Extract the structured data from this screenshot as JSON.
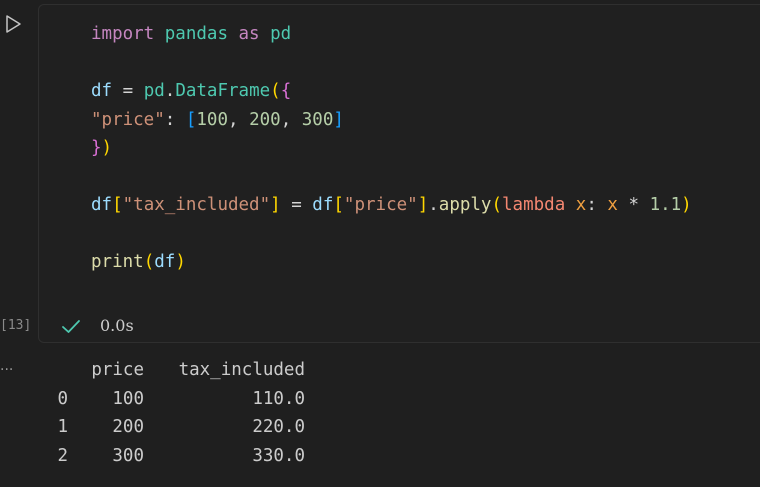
{
  "cell": {
    "execution_count": "[13]",
    "status_duration": "0.0s",
    "code_lines": [
      [
        {
          "t": "import",
          "c": "kw-import"
        },
        {
          "t": " ",
          "c": "op"
        },
        {
          "t": "pandas",
          "c": "mod"
        },
        {
          "t": " as ",
          "c": "kw-import"
        },
        {
          "t": "pd",
          "c": "mod"
        }
      ],
      [],
      [
        {
          "t": "df",
          "c": "var"
        },
        {
          "t": " = ",
          "c": "op"
        },
        {
          "t": "pd",
          "c": "mod"
        },
        {
          "t": ".",
          "c": "op"
        },
        {
          "t": "DataFrame",
          "c": "mod"
        },
        {
          "t": "(",
          "c": "b1"
        },
        {
          "t": "{",
          "c": "b2"
        }
      ],
      [
        {
          "t": "\"price\"",
          "c": "str"
        },
        {
          "t": ": ",
          "c": "op"
        },
        {
          "t": "[",
          "c": "b3"
        },
        {
          "t": "100",
          "c": "num"
        },
        {
          "t": ", ",
          "c": "op"
        },
        {
          "t": "200",
          "c": "num"
        },
        {
          "t": ", ",
          "c": "op"
        },
        {
          "t": "300",
          "c": "num"
        },
        {
          "t": "]",
          "c": "b3"
        }
      ],
      [
        {
          "t": "}",
          "c": "b2"
        },
        {
          "t": ")",
          "c": "b1"
        }
      ],
      [],
      [
        {
          "t": "df",
          "c": "var"
        },
        {
          "t": "[",
          "c": "b1"
        },
        {
          "t": "\"tax_included\"",
          "c": "str"
        },
        {
          "t": "]",
          "c": "b1"
        },
        {
          "t": " = ",
          "c": "op"
        },
        {
          "t": "df",
          "c": "var"
        },
        {
          "t": "[",
          "c": "b1"
        },
        {
          "t": "\"price\"",
          "c": "str"
        },
        {
          "t": "]",
          "c": "b1"
        },
        {
          "t": ".",
          "c": "op"
        },
        {
          "t": "apply",
          "c": "fn"
        },
        {
          "t": "(",
          "c": "b1"
        },
        {
          "t": "lambda",
          "c": "kw-lambda"
        },
        {
          "t": " ",
          "c": "op"
        },
        {
          "t": "x",
          "c": "param"
        },
        {
          "t": ": ",
          "c": "op"
        },
        {
          "t": "x",
          "c": "param"
        },
        {
          "t": " * ",
          "c": "op"
        },
        {
          "t": "1.1",
          "c": "num"
        },
        {
          "t": ")",
          "c": "b1"
        }
      ],
      [],
      [
        {
          "t": "print",
          "c": "fn"
        },
        {
          "t": "(",
          "c": "b1"
        },
        {
          "t": "df",
          "c": "var"
        },
        {
          "t": ")",
          "c": "b1"
        }
      ]
    ]
  },
  "output": {
    "columns": [
      "price",
      "tax_included"
    ],
    "rows": [
      {
        "index": "0",
        "price": "100",
        "tax_included": "110.0"
      },
      {
        "index": "1",
        "price": "200",
        "tax_included": "220.0"
      },
      {
        "index": "2",
        "price": "300",
        "tax_included": "330.0"
      }
    ],
    "more_label": "..."
  },
  "icons": {
    "run": "play-icon",
    "status": "check-icon",
    "more": "more-icon"
  },
  "colors": {
    "background": "#1f1f1f",
    "cell_border": "#2f2f2f",
    "check": "#4ec9b0"
  }
}
